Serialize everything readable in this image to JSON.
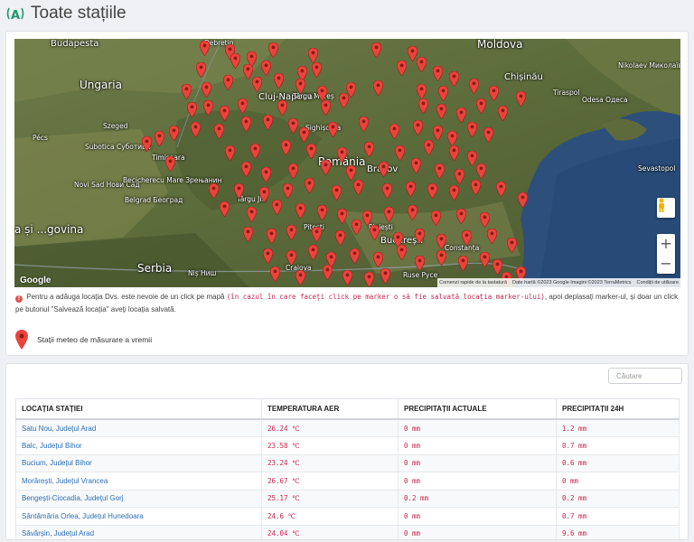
{
  "page": {
    "title": "Toate stațiile"
  },
  "map": {
    "labels": [
      {
        "text": "Budapesta",
        "size": "mid"
      },
      {
        "text": "Debrețin",
        "size": "small"
      },
      {
        "text": "Moldova",
        "size": "big"
      },
      {
        "text": "Ungaria",
        "size": "big"
      },
      {
        "text": "Chișinău",
        "size": "mid"
      },
      {
        "text": "Nikolaev Миколаїв",
        "size": "small"
      },
      {
        "text": "Cluj-Napoca",
        "size": "mid"
      },
      {
        "text": "Târgu Mureș",
        "size": "small"
      },
      {
        "text": "Tiraspol",
        "size": "small"
      },
      {
        "text": "Odesa Одеса",
        "size": "small"
      },
      {
        "text": "Szeged",
        "size": "small"
      },
      {
        "text": "Sighișoara",
        "size": "small"
      },
      {
        "text": "Pécs",
        "size": "small"
      },
      {
        "text": "Subotica Суботица",
        "size": "small"
      },
      {
        "text": "Timișoara",
        "size": "small"
      },
      {
        "text": "România",
        "size": "big"
      },
      {
        "text": "Brașov",
        "size": "mid"
      },
      {
        "text": "Novi Sad Нови Сад",
        "size": "small"
      },
      {
        "text": "Becicherecu Mare Зрењанин",
        "size": "small"
      },
      {
        "text": "Belgrad Београд",
        "size": "small"
      },
      {
        "text": "Târgu Jiu",
        "size": "small"
      },
      {
        "text": "Pitești",
        "size": "small"
      },
      {
        "text": "Ploiești",
        "size": "small"
      },
      {
        "text": "București",
        "size": "mid"
      },
      {
        "text": "Constanța",
        "size": "small"
      },
      {
        "text": "Serbia",
        "size": "big"
      },
      {
        "text": "Craiova",
        "size": "small"
      },
      {
        "text": "Niș Ниш",
        "size": "small"
      },
      {
        "text": "Ruse Русе",
        "size": "small"
      },
      {
        "text": "a și ...govina",
        "size": "big"
      },
      {
        "text": "Sevastopol",
        "size": "small"
      }
    ],
    "google_logo": "Google",
    "attribution": [
      "Comenzi rapide de la tastatură",
      "Date hartă ©2023 Google Imagini ©2023 TerraMetrics",
      "Condiții de utilizare"
    ],
    "zoom_in": "+",
    "zoom_out": "−",
    "marker_color": "#e8443d"
  },
  "info": {
    "part1": "Pentru a adăuga locația Dvs. este nevoie de un click pe mapă",
    "code": "(în cazul în care faceți click pe marker o să fie salvată locația marker-ului)",
    "part2": ", apoi deplasați marker-ul, și doar un click pe butonul \"Salvează locația\" aveți locația salvată."
  },
  "legend": {
    "label": "Stații meteo de măsurare a vremii"
  },
  "search": {
    "placeholder": "Căutare"
  },
  "table": {
    "headers": [
      "LOCAȚIA STAȚIEI",
      "TEMPERATURA AER",
      "PRECIPITAȚII ACTUALE",
      "PRECIPITAȚII 24H"
    ],
    "rows": [
      {
        "location": "Satu Nou, Județul Arad",
        "temp": "26.24 ℃",
        "precip_now": "0 mm",
        "precip_24h": "1.2 mm"
      },
      {
        "location": "Balc, Județul Bihor",
        "temp": "23.58 ℃",
        "precip_now": "0 mm",
        "precip_24h": "0.7 mm"
      },
      {
        "location": "Bucium, Județul Bihor",
        "temp": "23.24 ℃",
        "precip_now": "0 mm",
        "precip_24h": "0.6 mm"
      },
      {
        "location": "Morărești, Județul Vrancea",
        "temp": "26.67 ℃",
        "precip_now": "0 mm",
        "precip_24h": "0 mm"
      },
      {
        "location": "Bengești-Ciocadia, Județul Gorj",
        "temp": "25.17 ℃",
        "precip_now": "0.2 mm",
        "precip_24h": "0.2 mm"
      },
      {
        "location": "Sântămăria Orlea, Județul Hunedoara",
        "temp": "24.6 ℃",
        "precip_now": "0 mm",
        "precip_24h": "0.7 mm"
      },
      {
        "location": "Săvârșin, Județul Arad",
        "temp": "24.04 ℃",
        "precip_now": "0 mm",
        "precip_24h": "9.6 mm"
      }
    ]
  }
}
